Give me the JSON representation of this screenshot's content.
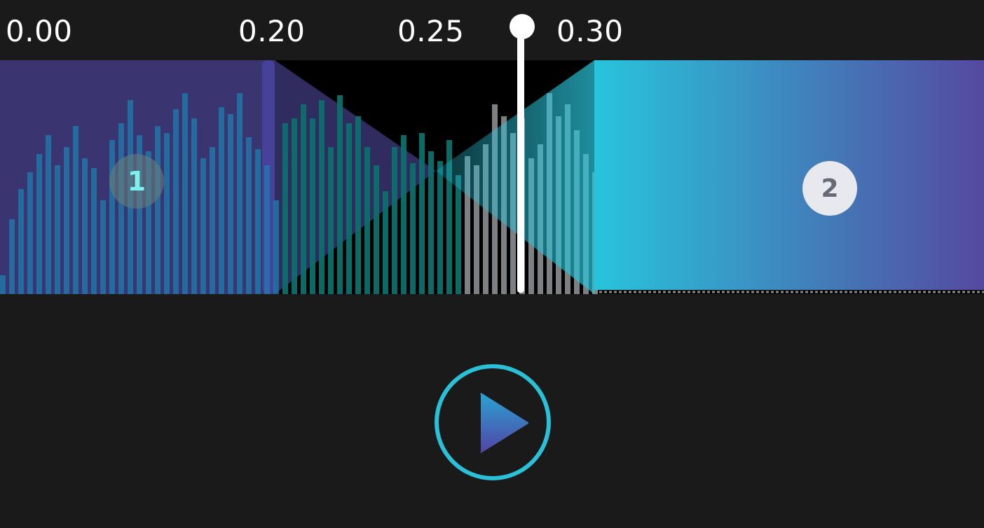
{
  "ruler": {
    "ticks": [
      "0.00",
      "0.20",
      "0.25",
      "0.30"
    ]
  },
  "clips": {
    "clip1_label": "1",
    "clip2_label": "2"
  },
  "colors": {
    "background": "#1a1a1a",
    "clip1_fill": "#3a3470",
    "waveform_blue": "#1e7fb0",
    "waveform_teal": "#0c6f6c",
    "clip2_gradient_start": "#28c4dc",
    "clip2_gradient_end": "#5549a0",
    "play_ring": "#29c0d8",
    "playhead": "#ffffff"
  },
  "icons": {
    "play": "play-icon"
  }
}
